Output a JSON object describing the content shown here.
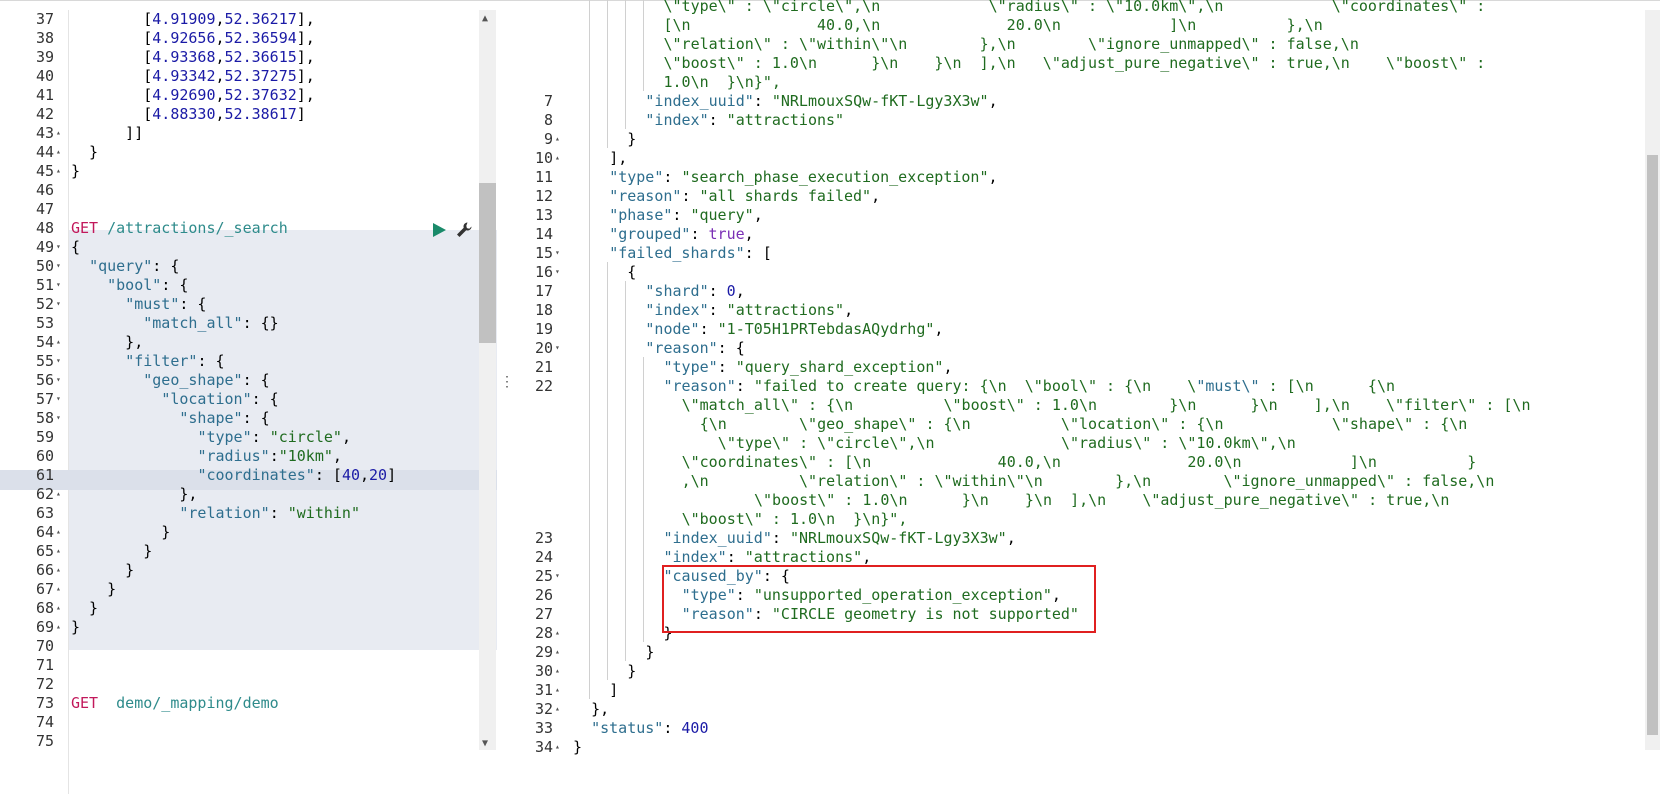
{
  "request_editor": {
    "lines": [
      {
        "n": "37",
        "fold": "",
        "text": "        [4.91909,52.36217],"
      },
      {
        "n": "38",
        "fold": "",
        "text": "        [4.92656,52.36594],"
      },
      {
        "n": "39",
        "fold": "",
        "text": "        [4.93368,52.36615],"
      },
      {
        "n": "40",
        "fold": "",
        "text": "        [4.93342,52.37275],"
      },
      {
        "n": "41",
        "fold": "",
        "text": "        [4.92690,52.37632],"
      },
      {
        "n": "42",
        "fold": "",
        "text": "        [4.88330,52.38617]"
      },
      {
        "n": "43",
        "fold": "up",
        "text": "      ]]"
      },
      {
        "n": "44",
        "fold": "up",
        "text": "  }"
      },
      {
        "n": "45",
        "fold": "up",
        "text": "}"
      },
      {
        "n": "46",
        "fold": "",
        "text": ""
      },
      {
        "n": "47",
        "fold": "",
        "text": ""
      },
      {
        "n": "48",
        "fold": "",
        "text": "GET /attractions/_search"
      },
      {
        "n": "49",
        "fold": "down",
        "text": "{"
      },
      {
        "n": "50",
        "fold": "down",
        "text": "  \"query\": {"
      },
      {
        "n": "51",
        "fold": "down",
        "text": "    \"bool\": {"
      },
      {
        "n": "52",
        "fold": "down",
        "text": "      \"must\": {"
      },
      {
        "n": "53",
        "fold": "",
        "text": "        \"match_all\": {}"
      },
      {
        "n": "54",
        "fold": "up",
        "text": "      },"
      },
      {
        "n": "55",
        "fold": "down",
        "text": "      \"filter\": {"
      },
      {
        "n": "56",
        "fold": "down",
        "text": "        \"geo_shape\": {"
      },
      {
        "n": "57",
        "fold": "down",
        "text": "          \"location\": {"
      },
      {
        "n": "58",
        "fold": "down",
        "text": "            \"shape\": {"
      },
      {
        "n": "59",
        "fold": "",
        "text": "              \"type\": \"circle\","
      },
      {
        "n": "60",
        "fold": "",
        "text": "              \"radius\":\"10km\","
      },
      {
        "n": "61",
        "fold": "",
        "text": "              \"coordinates\": [40,20]"
      },
      {
        "n": "62",
        "fold": "up",
        "text": "            },"
      },
      {
        "n": "63",
        "fold": "",
        "text": "            \"relation\": \"within\""
      },
      {
        "n": "64",
        "fold": "up",
        "text": "          }"
      },
      {
        "n": "65",
        "fold": "up",
        "text": "        }"
      },
      {
        "n": "66",
        "fold": "up",
        "text": "      }"
      },
      {
        "n": "67",
        "fold": "up",
        "text": "    }"
      },
      {
        "n": "68",
        "fold": "up",
        "text": "  }"
      },
      {
        "n": "69",
        "fold": "up",
        "text": "}"
      },
      {
        "n": "70",
        "fold": "",
        "text": ""
      },
      {
        "n": "71",
        "fold": "",
        "text": ""
      },
      {
        "n": "72",
        "fold": "",
        "text": ""
      },
      {
        "n": "73",
        "fold": "",
        "text": "GET  demo/_mapping/demo"
      },
      {
        "n": "74",
        "fold": "",
        "text": ""
      },
      {
        "n": "75",
        "fold": "",
        "text": ""
      }
    ]
  },
  "response_viewer": {
    "lines": [
      {
        "n": "",
        "fold": "",
        "indent": 5,
        "text": "\\\"type\\\" : \\\"circle\\\",\\n            \\\"radius\\\" : \\\"10.0km\\\",\\n            \\\"coordinates\\\" : "
      },
      {
        "n": "",
        "fold": "",
        "indent": 5,
        "text": "[\\n              40.0,\\n              20.0\\n            ]\\n          },\\n"
      },
      {
        "n": "",
        "fold": "",
        "indent": 5,
        "text": "\\\"relation\\\" : \\\"within\\\"\\n        },\\n        \\\"ignore_unmapped\\\" : false,\\n"
      },
      {
        "n": "",
        "fold": "",
        "indent": 5,
        "text": "\\\"boost\\\" : 1.0\\n      }\\n    }\\n  ],\\n   \\\"adjust_pure_negative\\\" : true,\\n    \\\"boost\\\" :"
      },
      {
        "n": "",
        "fold": "",
        "indent": 5,
        "text": "1.0\\n  }\\n}\","
      },
      {
        "n": "7",
        "fold": "",
        "indent": 4,
        "text": "\"index_uuid\": \"NRLmouxSQw-fKT-Lgy3X3w\","
      },
      {
        "n": "8",
        "fold": "",
        "indent": 4,
        "text": "\"index\": \"attractions\""
      },
      {
        "n": "9",
        "fold": "up",
        "indent": 3,
        "text": "}"
      },
      {
        "n": "10",
        "fold": "up",
        "indent": 2,
        "text": "],"
      },
      {
        "n": "11",
        "fold": "",
        "indent": 2,
        "text": "\"type\": \"search_phase_execution_exception\","
      },
      {
        "n": "12",
        "fold": "",
        "indent": 2,
        "text": "\"reason\": \"all shards failed\","
      },
      {
        "n": "13",
        "fold": "",
        "indent": 2,
        "text": "\"phase\": \"query\","
      },
      {
        "n": "14",
        "fold": "",
        "indent": 2,
        "text": "\"grouped\": true,"
      },
      {
        "n": "15",
        "fold": "down",
        "indent": 2,
        "text": "\"failed_shards\": ["
      },
      {
        "n": "16",
        "fold": "down",
        "indent": 3,
        "text": "{"
      },
      {
        "n": "17",
        "fold": "",
        "indent": 4,
        "text": "\"shard\": 0,"
      },
      {
        "n": "18",
        "fold": "",
        "indent": 4,
        "text": "\"index\": \"attractions\","
      },
      {
        "n": "19",
        "fold": "",
        "indent": 4,
        "text": "\"node\": \"1-T05H1PRTebdasAQydrhg\","
      },
      {
        "n": "20",
        "fold": "down",
        "indent": 4,
        "text": "\"reason\": {"
      },
      {
        "n": "21",
        "fold": "",
        "indent": 5,
        "text": "\"type\": \"query_shard_exception\","
      },
      {
        "n": "22",
        "fold": "",
        "indent": 5,
        "text": "\"reason\": \"failed to create query: {\\n  \\\"bool\\\" : {\\n    \\\"must\\\" : [\\n      {\\n"
      },
      {
        "n": "",
        "fold": "",
        "indent": 6,
        "text": "\\\"match_all\\\" : {\\n          \\\"boost\\\" : 1.0\\n        }\\n      }\\n    ],\\n    \\\"filter\\\" : [\\n"
      },
      {
        "n": "",
        "fold": "",
        "indent": 7,
        "text": "{\\n        \\\"geo_shape\\\" : {\\n          \\\"location\\\" : {\\n            \\\"shape\\\" : {\\n"
      },
      {
        "n": "",
        "fold": "",
        "indent": 8,
        "text": "\\\"type\\\" : \\\"circle\\\",\\n              \\\"radius\\\" : \\\"10.0km\\\",\\n"
      },
      {
        "n": "",
        "fold": "",
        "indent": 6,
        "text": "\\\"coordinates\\\" : [\\n              40.0,\\n              20.0\\n            ]\\n          }"
      },
      {
        "n": "",
        "fold": "",
        "indent": 6,
        "text": ",\\n          \\\"relation\\\" : \\\"within\\\"\\n        },\\n        \\\"ignore_unmapped\\\" : false,\\n"
      },
      {
        "n": "",
        "fold": "",
        "indent": 10,
        "text": "\\\"boost\\\" : 1.0\\n      }\\n    }\\n  ],\\n    \\\"adjust_pure_negative\\\" : true,\\n"
      },
      {
        "n": "",
        "fold": "",
        "indent": 6,
        "text": "\\\"boost\\\" : 1.0\\n  }\\n}\","
      },
      {
        "n": "23",
        "fold": "",
        "indent": 5,
        "text": "\"index_uuid\": \"NRLmouxSQw-fKT-Lgy3X3w\","
      },
      {
        "n": "24",
        "fold": "",
        "indent": 5,
        "text": "\"index\": \"attractions\","
      },
      {
        "n": "25",
        "fold": "down",
        "indent": 5,
        "text": "\"caused_by\": {"
      },
      {
        "n": "26",
        "fold": "",
        "indent": 6,
        "text": "\"type\": \"unsupported_operation_exception\","
      },
      {
        "n": "27",
        "fold": "",
        "indent": 6,
        "text": "\"reason\": \"CIRCLE geometry is not supported\""
      },
      {
        "n": "28",
        "fold": "up",
        "indent": 5,
        "text": "}"
      },
      {
        "n": "29",
        "fold": "up",
        "indent": 4,
        "text": "}"
      },
      {
        "n": "30",
        "fold": "up",
        "indent": 3,
        "text": "}"
      },
      {
        "n": "31",
        "fold": "up",
        "indent": 2,
        "text": "]"
      },
      {
        "n": "32",
        "fold": "up",
        "indent": 1,
        "text": "},"
      },
      {
        "n": "33",
        "fold": "",
        "indent": 1,
        "text": "\"status\": 400"
      },
      {
        "n": "34",
        "fold": "up",
        "indent": 0,
        "text": "}"
      }
    ]
  },
  "icons": {
    "run": "play-triangle-icon",
    "settings": "wrench-icon",
    "resize": "vertical-ellipsis-icon"
  },
  "colors": {
    "key": "#2e6e8e",
    "string": "#1f6b1f",
    "number": "#1a1aa6",
    "method": "#c2185b",
    "highlight_border": "#e02020",
    "run_green": "#1a8a6a"
  }
}
